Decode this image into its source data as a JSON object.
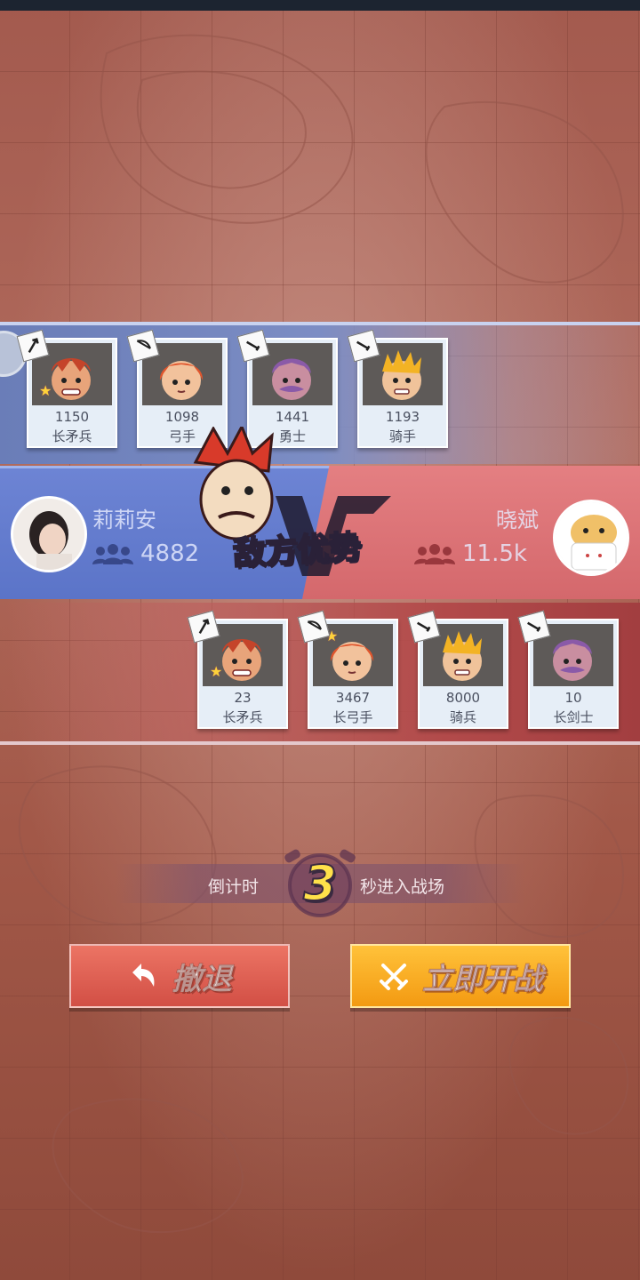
{
  "top_team": {
    "units": [
      {
        "count": "1150",
        "name": "长矛兵",
        "icon": "spear-icon"
      },
      {
        "count": "1098",
        "name": "弓手",
        "icon": "bow-icon"
      },
      {
        "count": "1441",
        "name": "勇士",
        "icon": "sword-icon"
      },
      {
        "count": "1193",
        "name": "骑手",
        "icon": "sword-icon"
      }
    ]
  },
  "versus": {
    "left_player": {
      "name": "莉莉安",
      "power": "4882"
    },
    "right_player": {
      "name": "晓斌",
      "power": "11.5k"
    },
    "status": "敌方优势"
  },
  "bottom_team": {
    "units": [
      {
        "count": "23",
        "name": "长矛兵",
        "icon": "spear-icon"
      },
      {
        "count": "3467",
        "name": "长弓手",
        "icon": "bow-icon"
      },
      {
        "count": "8000",
        "name": "骑兵",
        "icon": "sword-icon"
      },
      {
        "count": "10",
        "name": "长剑士",
        "icon": "sword-icon"
      }
    ]
  },
  "countdown": {
    "prefix": "倒计时",
    "seconds": "3",
    "suffix": "秒进入战场"
  },
  "buttons": {
    "retreat": "撤退",
    "battle": "立即开战"
  },
  "colors": {
    "blue_team": "#5b74c8",
    "red_team": "#d4686c",
    "retreat": "#d24f45",
    "battle": "#f39a12",
    "countdown": "#ffe14a"
  }
}
